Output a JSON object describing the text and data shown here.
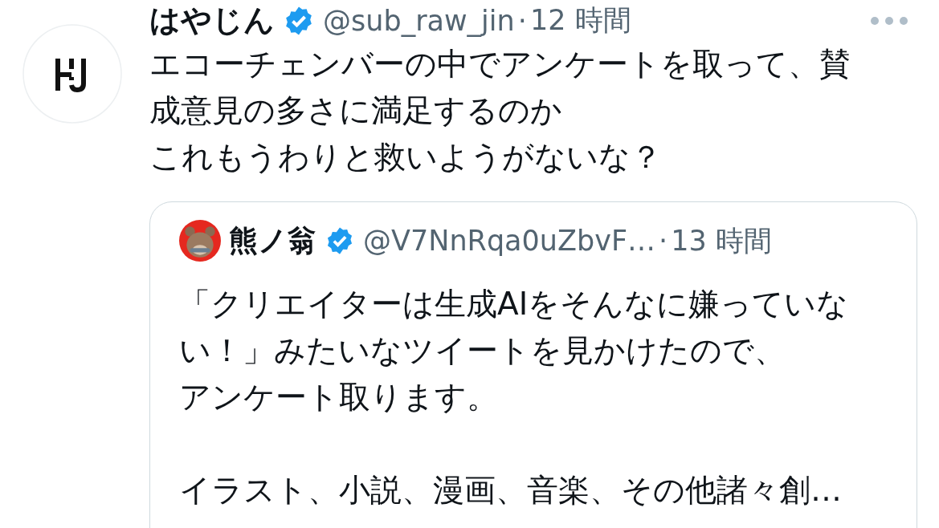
{
  "tweet": {
    "author": {
      "name": "はやじん",
      "verified": true,
      "handle": "@sub_raw_jin",
      "separator": "·",
      "time": "12 時間"
    },
    "lines": [
      "エコーチェンバーの中でアンケートを取って、賛成意見の多さに満足するのか",
      "これもうわりと救いようがないな？"
    ],
    "quote": {
      "author": {
        "name": "熊ノ翁",
        "verified": true,
        "handle": "@V7NnRqa0uZbvF…",
        "separator": "·",
        "time": "13 時間"
      },
      "paragraphs": [
        [
          "「クリエイターは生成AIをそんなに嫌っていない！」みたいなツイートを見かけたので、",
          "アンケート取ります。"
        ],
        [
          "イラスト、小説、漫画、音楽、その他諸々創…"
        ]
      ]
    }
  }
}
